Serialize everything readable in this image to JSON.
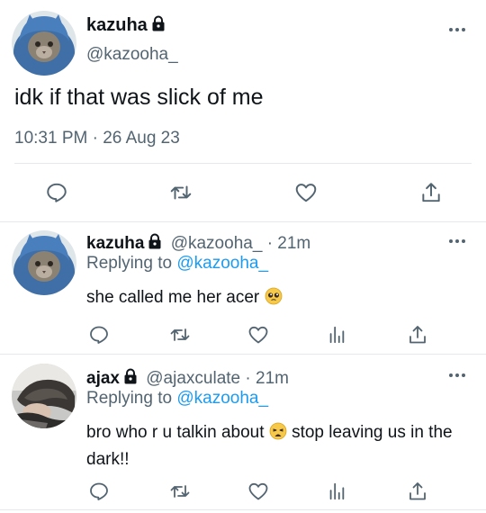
{
  "main_tweet": {
    "name": "kazuha",
    "handle": "@kazooha_",
    "text": "idk if that was slick of me",
    "timestamp": "10:31 PM · 26 Aug 23",
    "icons": [
      "reply-icon",
      "retweet-icon",
      "like-icon",
      "share-icon"
    ]
  },
  "replies": [
    {
      "name": "kazuha",
      "handle": "@kazooha_",
      "time": "· 21m",
      "replying_prefix": "Replying to",
      "replying_to": "@kazooha_",
      "text": "she called me her acer",
      "emoji": "pleading-face-emoji"
    },
    {
      "name": "ajax",
      "handle": "@ajaxculate",
      "time": "· 21m",
      "replying_prefix": "Replying to",
      "replying_to": "@kazooha_",
      "text_before": "bro who r u talkin about",
      "emoji": "weary-face-emoji",
      "text_after": "stop leaving us in the dark!!"
    }
  ],
  "colors": {
    "text": "#0f1419",
    "muted": "#536471",
    "link": "#1d9bf0",
    "divider": "#e6e9ec"
  }
}
